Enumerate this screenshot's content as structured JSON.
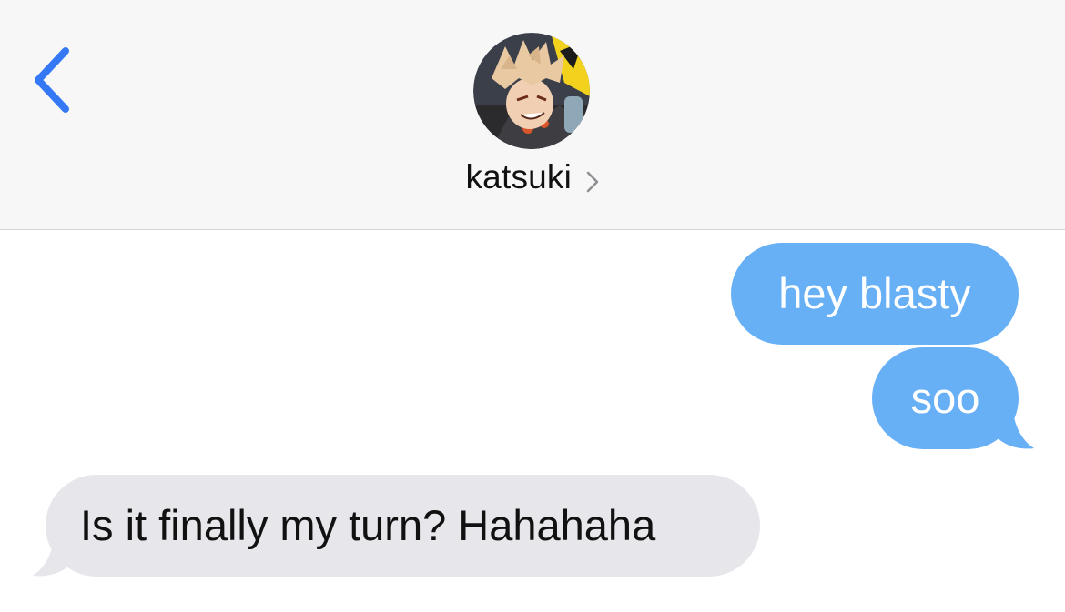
{
  "header": {
    "contact_name": "katsuki",
    "back_icon": "chevron-left-icon",
    "chevron_icon": "chevron-right-icon",
    "avatar_icon": "avatar"
  },
  "colors": {
    "accent": "#3478f6",
    "sent_bubble": "#67b0f6",
    "received_bubble": "#e6e6eb",
    "header_bg": "#f7f7f7"
  },
  "messages": [
    {
      "direction": "sent",
      "text": "hey blasty"
    },
    {
      "direction": "sent",
      "text": "soo"
    },
    {
      "direction": "received",
      "text": "Is it finally my turn? Hahahaha"
    }
  ]
}
